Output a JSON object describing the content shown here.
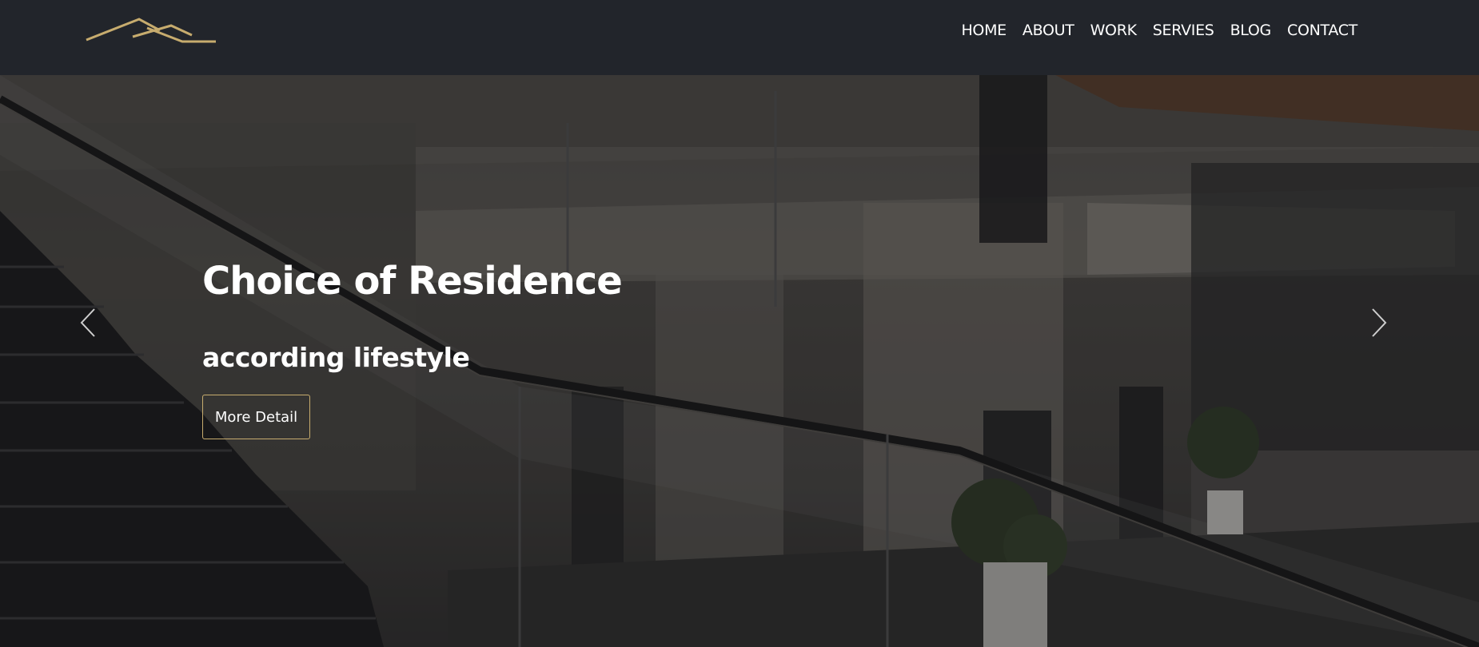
{
  "brand": {
    "logo_icon": "roof-lines-logo",
    "accent_color": "#c7ac6e"
  },
  "nav": {
    "items": [
      {
        "label": "HOME"
      },
      {
        "label": "ABOUT"
      },
      {
        "label": "WORK"
      },
      {
        "label": "SERVIES"
      },
      {
        "label": "BLOG"
      },
      {
        "label": "CONTACT"
      }
    ]
  },
  "hero": {
    "title": "Choice of Residence",
    "subtitle": "according lifestyle",
    "button_label": "More Detail",
    "prev_icon": "chevron-left-icon",
    "next_icon": "chevron-right-icon"
  },
  "colors": {
    "navbar_bg": "#22252b",
    "text": "#ffffff"
  }
}
